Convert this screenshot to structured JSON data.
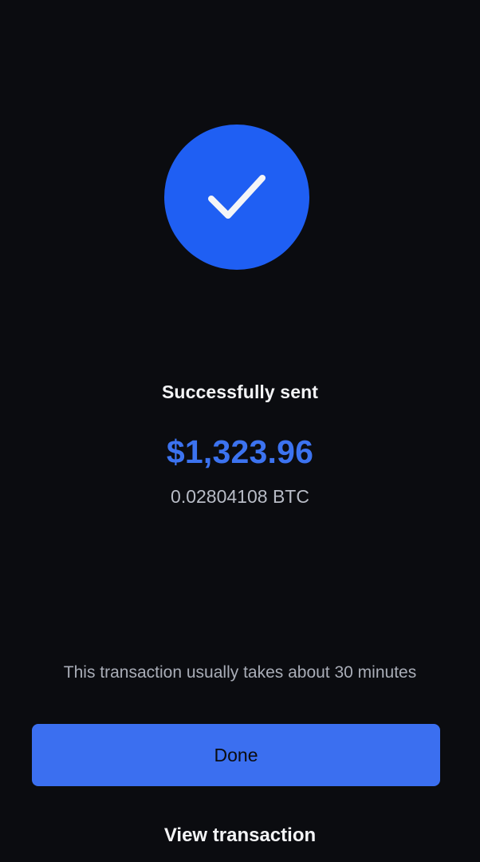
{
  "status": {
    "icon": "checkmark-icon",
    "circle_color": "#1f5ff3",
    "title": "Successfully sent"
  },
  "amount": {
    "fiat": "$1,323.96",
    "crypto": "0.02804108 BTC",
    "fiat_color": "#3c73f0"
  },
  "note": "This transaction usually takes about 30 minutes",
  "actions": {
    "done_label": "Done",
    "done_color": "#3b6ff0",
    "view_label": "View transaction"
  },
  "theme": {
    "background": "#0b0c10"
  }
}
